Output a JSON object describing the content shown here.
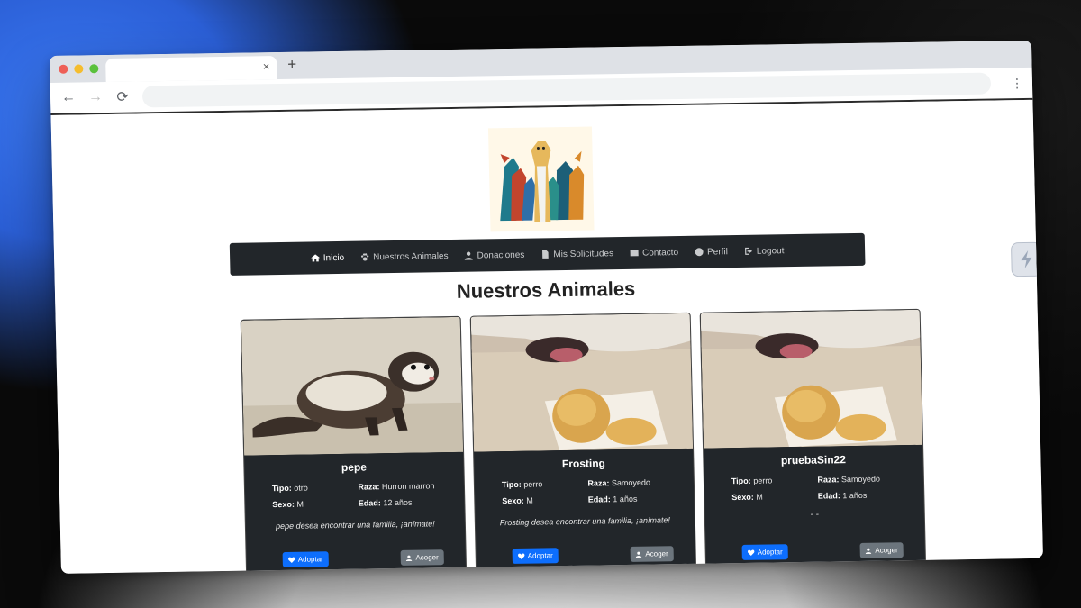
{
  "browser": {
    "tab_close": "×",
    "new_tab": "+",
    "back_icon": "←",
    "forward_icon": "→",
    "reload_icon": "⟳",
    "menu_icon": "⋮"
  },
  "navbar": {
    "items": [
      {
        "label": "Inicio",
        "icon": "home-icon"
      },
      {
        "label": "Nuestros Animales",
        "icon": "paw-icon"
      },
      {
        "label": "Donaciones",
        "icon": "user-icon"
      },
      {
        "label": "Mis Solicitudes",
        "icon": "file-icon"
      },
      {
        "label": "Contacto",
        "icon": "envelope-icon"
      },
      {
        "label": "Perfil",
        "icon": "user-circle-icon"
      },
      {
        "label": "Logout",
        "icon": "logout-icon"
      }
    ]
  },
  "main": {
    "title": "Nuestros Animales"
  },
  "cards": [
    {
      "name": "pepe",
      "tipo_label": "Tipo:",
      "tipo": "otro",
      "raza_label": "Raza:",
      "raza": "Hurron marron",
      "sexo_label": "Sexo:",
      "sexo": "M",
      "edad_label": "Edad:",
      "edad": "12 años",
      "description": "pepe desea encontrar una familia, ¡anímate!",
      "adopt_label": "Adoptar",
      "foster_label": "Acoger"
    },
    {
      "name": "Frosting",
      "tipo_label": "Tipo:",
      "tipo": "perro",
      "raza_label": "Raza:",
      "raza": "Samoyedo",
      "sexo_label": "Sexo:",
      "sexo": "M",
      "edad_label": "Edad:",
      "edad": "1 años",
      "description": "Frosting desea encontrar una familia, ¡anímate!",
      "adopt_label": "Adoptar",
      "foster_label": "Acoger"
    },
    {
      "name": "pruebaSin22",
      "tipo_label": "Tipo:",
      "tipo": "perro",
      "raza_label": "Raza:",
      "raza": "Samoyedo",
      "sexo_label": "Sexo:",
      "sexo": "M",
      "edad_label": "Edad:",
      "edad": "1 años",
      "description": "- -",
      "adopt_label": "Adoptar",
      "foster_label": "Acoger"
    }
  ],
  "colors": {
    "navbar_bg": "#22262a",
    "primary": "#0d6efd",
    "secondary": "#6c757d"
  }
}
